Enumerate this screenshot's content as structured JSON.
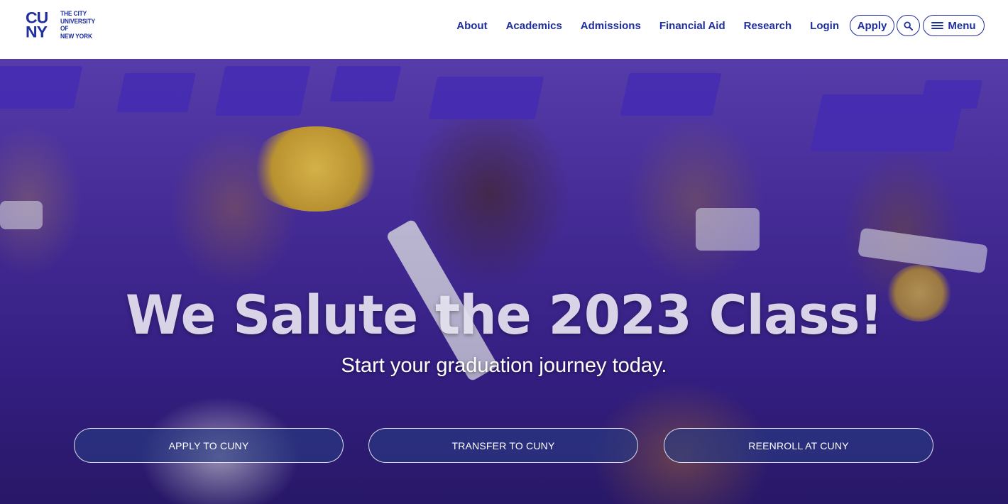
{
  "brand": {
    "logo_top": "CU",
    "logo_bottom": "NY",
    "logo_lines": [
      "THE CITY",
      "UNIVERSITY",
      "OF",
      "NEW YORK"
    ],
    "color": "#1f2f9f"
  },
  "nav": {
    "links": [
      "About",
      "Academics",
      "Admissions",
      "Financial Aid",
      "Research",
      "Login"
    ],
    "apply_label": "Apply",
    "search_icon": "search-icon",
    "menu_label": "Menu",
    "menu_icon": "hamburger-icon"
  },
  "hero": {
    "headline": "We Salute the 2023 Class!",
    "subheadline": "Start your graduation journey today.",
    "buttons": [
      "APPLY TO CUNY",
      "TRANSFER TO CUNY",
      "REENROLL AT CUNY"
    ]
  }
}
